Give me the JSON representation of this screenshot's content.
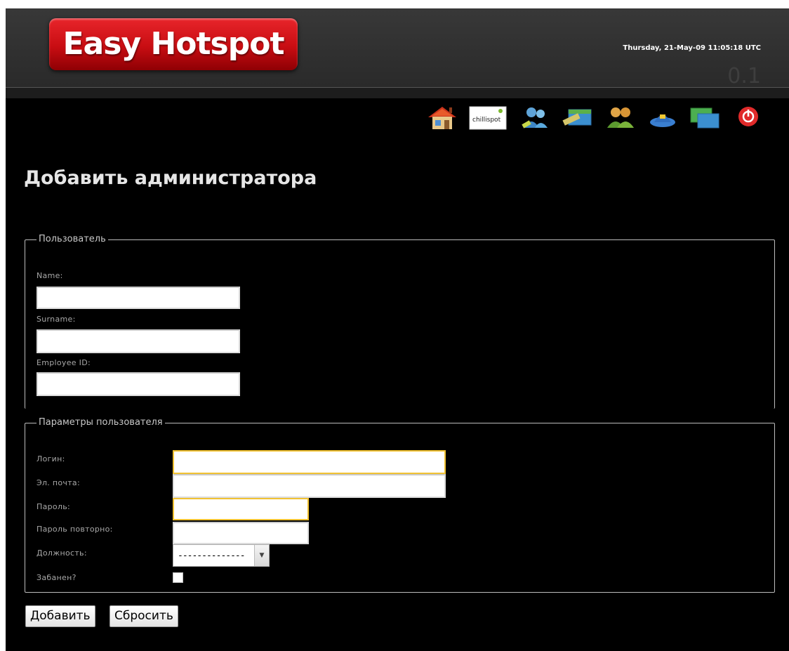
{
  "header": {
    "logo_text": "Easy Hotspot",
    "datetime": "Thursday, 21-May-09 11:05:18 UTC",
    "version": "0.1"
  },
  "toolbar": {
    "icons": [
      "home-icon",
      "chillispot-icon",
      "users-icon",
      "tickets-icon",
      "group-users-icon",
      "admin-icon",
      "network-icon",
      "logout-icon"
    ],
    "chillispot_text": "chillispot"
  },
  "page_title": "Добавить администратора",
  "user_section": {
    "legend": "Пользователь",
    "name_label": "Name:",
    "surname_label": "Surname:",
    "employee_id_label": "Employee ID:",
    "name_value": "",
    "surname_value": "",
    "employee_id_value": ""
  },
  "params_section": {
    "legend": "Параметры пользователя",
    "login_label": "Логин:",
    "email_label": "Эл. почта:",
    "password_label": "Пароль:",
    "password_repeat_label": "Пароль повторно:",
    "position_label": "Должность:",
    "banned_label": "Забанен?",
    "position_selected": "--------------",
    "banned_checked": false
  },
  "buttons": {
    "add": "Добавить",
    "reset": "Сбросить"
  },
  "colors": {
    "background": "#000000",
    "header": "#333333",
    "logo": "#d7161c",
    "focus_border": "#f1c232"
  }
}
